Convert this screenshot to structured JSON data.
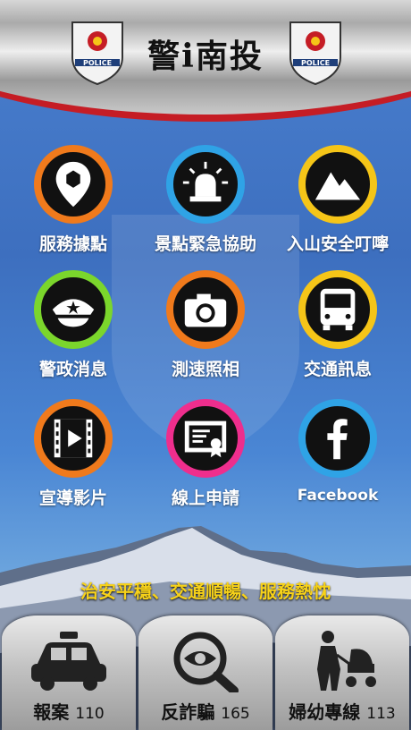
{
  "header": {
    "title": "警i南投",
    "badge_text": "POLICE"
  },
  "grid": [
    {
      "label": "服務據點",
      "icon": "location-pin-icon",
      "ring": "#f07a1c"
    },
    {
      "label": "景點緊急協助",
      "icon": "emergency-light-icon",
      "ring": "#2fa3e6"
    },
    {
      "label": "入山安全叮嚀",
      "icon": "mountain-icon",
      "ring": "#f5c518"
    },
    {
      "label": "警政消息",
      "icon": "police-cap-icon",
      "ring": "#7bd62c"
    },
    {
      "label": "測速照相",
      "icon": "camera-icon",
      "ring": "#f07a1c"
    },
    {
      "label": "交通訊息",
      "icon": "bus-icon",
      "ring": "#f5c518"
    },
    {
      "label": "宣導影片",
      "icon": "film-icon",
      "ring": "#f07a1c"
    },
    {
      "label": "線上申請",
      "icon": "certificate-icon",
      "ring": "#ee2e8d"
    },
    {
      "label": "Facebook",
      "icon": "facebook-icon",
      "ring": "#2fa3e6"
    }
  ],
  "slogan": "治安平穩、交通順暢、服務熱忱",
  "bottom": [
    {
      "label": "報案",
      "number": "110",
      "icon": "police-car-icon"
    },
    {
      "label": "反詐騙",
      "number": "165",
      "icon": "magnifier-eye-icon"
    },
    {
      "label": "婦幼專線",
      "number": "113",
      "icon": "mother-stroller-icon"
    }
  ]
}
